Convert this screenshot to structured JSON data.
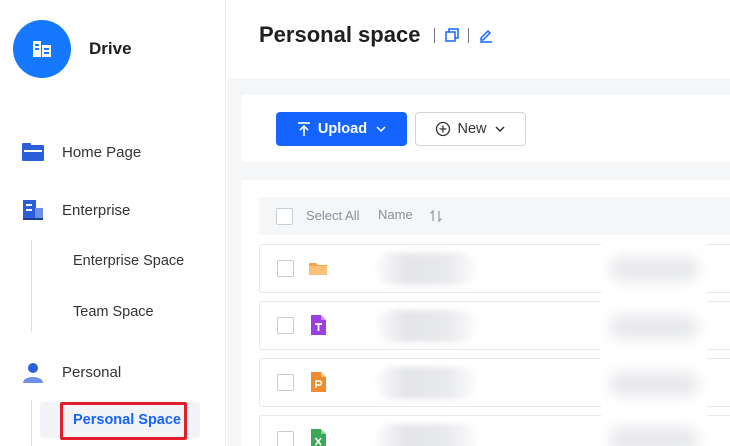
{
  "brand": {
    "name": "Drive"
  },
  "sidebar": {
    "items": [
      {
        "label": "Home Page"
      },
      {
        "label": "Enterprise"
      },
      {
        "label": "Personal"
      }
    ],
    "enterprise_children": [
      {
        "label": "Enterprise Space"
      },
      {
        "label": "Team Space"
      }
    ],
    "personal_children": [
      {
        "label": "Personal Space",
        "active": true
      }
    ]
  },
  "header": {
    "title": "Personal space"
  },
  "toolbar": {
    "upload_label": "Upload",
    "new_label": "New"
  },
  "list": {
    "select_all_label": "Select All",
    "name_column_label": "Name",
    "rows": [
      {
        "type": "folder",
        "icon": "folder-icon"
      },
      {
        "type": "text-document",
        "icon": "text-file-icon"
      },
      {
        "type": "presentation",
        "icon": "presentation-file-icon"
      },
      {
        "type": "spreadsheet",
        "icon": "spreadsheet-file-icon"
      }
    ]
  },
  "colors": {
    "accent": "#1664ff",
    "highlight": "#e11d2e",
    "folder": "#f7a24b",
    "text_file": "#9b3fe0",
    "presentation_file": "#f08c2d",
    "spreadsheet_file": "#3aa856"
  }
}
